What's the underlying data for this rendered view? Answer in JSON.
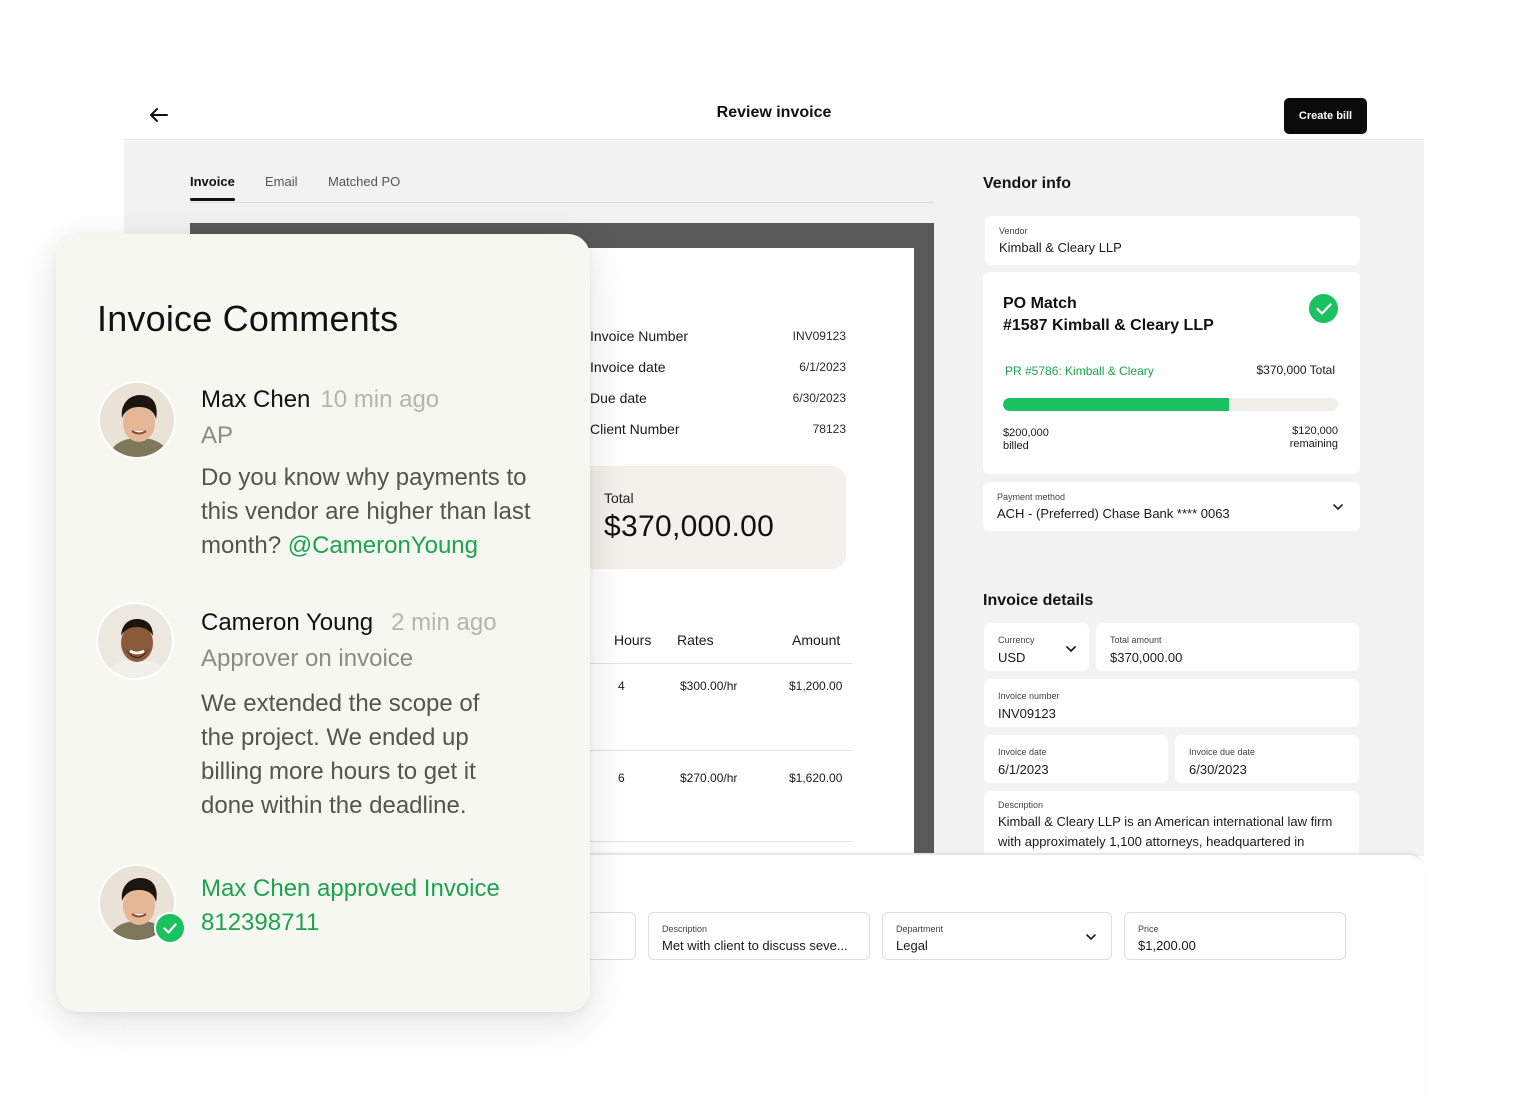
{
  "header": {
    "title": "Review invoice",
    "create_bill_label": "Create bill"
  },
  "tabs": [
    {
      "label": "Invoice",
      "active": true
    },
    {
      "label": "Email",
      "active": false
    },
    {
      "label": "Matched PO",
      "active": false
    }
  ],
  "document": {
    "fields": [
      {
        "label": "Invoice Number",
        "value": "INV09123"
      },
      {
        "label": "Invoice date",
        "value": "6/1/2023"
      },
      {
        "label": "Due date",
        "value": "6/30/2023"
      },
      {
        "label": "Client Number",
        "value": "78123"
      }
    ],
    "total_label": "Total",
    "total_value": "$370,000.00",
    "table": {
      "headers": [
        "Hours",
        "Rates",
        "Amount"
      ],
      "rows": [
        {
          "hours": "4",
          "rate": "$300.00/hr",
          "amount": "$1,200.00"
        },
        {
          "hours": "6",
          "rate": "$270.00/hr",
          "amount": "$1,620.00"
        }
      ]
    }
  },
  "vendor_info": {
    "title": "Vendor info",
    "vendor_label": "Vendor",
    "vendor_value": "Kimball & Cleary LLP",
    "po_match": {
      "title_line1": "PO Match",
      "title_line2": "#1587 Kimball & Cleary LLP",
      "pr_link": "PR #5786: Kimball & Cleary",
      "total": "$370,000 Total",
      "billed_amount": "$200,000",
      "billed_label": "billed",
      "remaining_amount": "$120,000",
      "remaining_label": "remaining",
      "progress_fraction": 0.675,
      "accent_color": "#19c15f"
    },
    "payment_label": "Payment method",
    "payment_value": "ACH - (Preferred) Chase Bank **** 0063"
  },
  "invoice_details": {
    "title": "Invoice details",
    "currency_label": "Currency",
    "currency_value": "USD",
    "total_amount_label": "Total amount",
    "total_amount_value": "$370,000.00",
    "invoice_number_label": "Invoice number",
    "invoice_number_value": "INV09123",
    "invoice_date_label": "Invoice date",
    "invoice_date_value": "6/1/2023",
    "due_date_label": "Invoice due date",
    "due_date_value": "6/30/2023",
    "description_label": "Description",
    "description_value": "Kimball & Cleary  LLP is an American international law firm with approximately 1,100 attorneys, headquartered in"
  },
  "line_item": {
    "description_label": "Description",
    "description_value": "Met with client to discuss seve...",
    "department_label": "Department",
    "department_value": "Legal",
    "price_label": "Price",
    "price_value": "$1,200.00"
  },
  "comments": {
    "title": "Invoice Comments",
    "items": [
      {
        "name": "Max Chen",
        "time": "10 min ago",
        "role": "AP",
        "body": "Do you know why payments to this vendor are higher than last month?",
        "mention": "@CameronYoung"
      },
      {
        "name": "Cameron Young",
        "time": "2 min ago",
        "role": "Approver on invoice",
        "body": "We extended the scope of the project. We ended up billing more hours to get it done within the deadline."
      }
    ],
    "approval_text": "Max Chen approved Invoice 812398711"
  },
  "icons": [
    "back-arrow-icon",
    "check-icon",
    "chevron-down-icon",
    "avatar"
  ]
}
